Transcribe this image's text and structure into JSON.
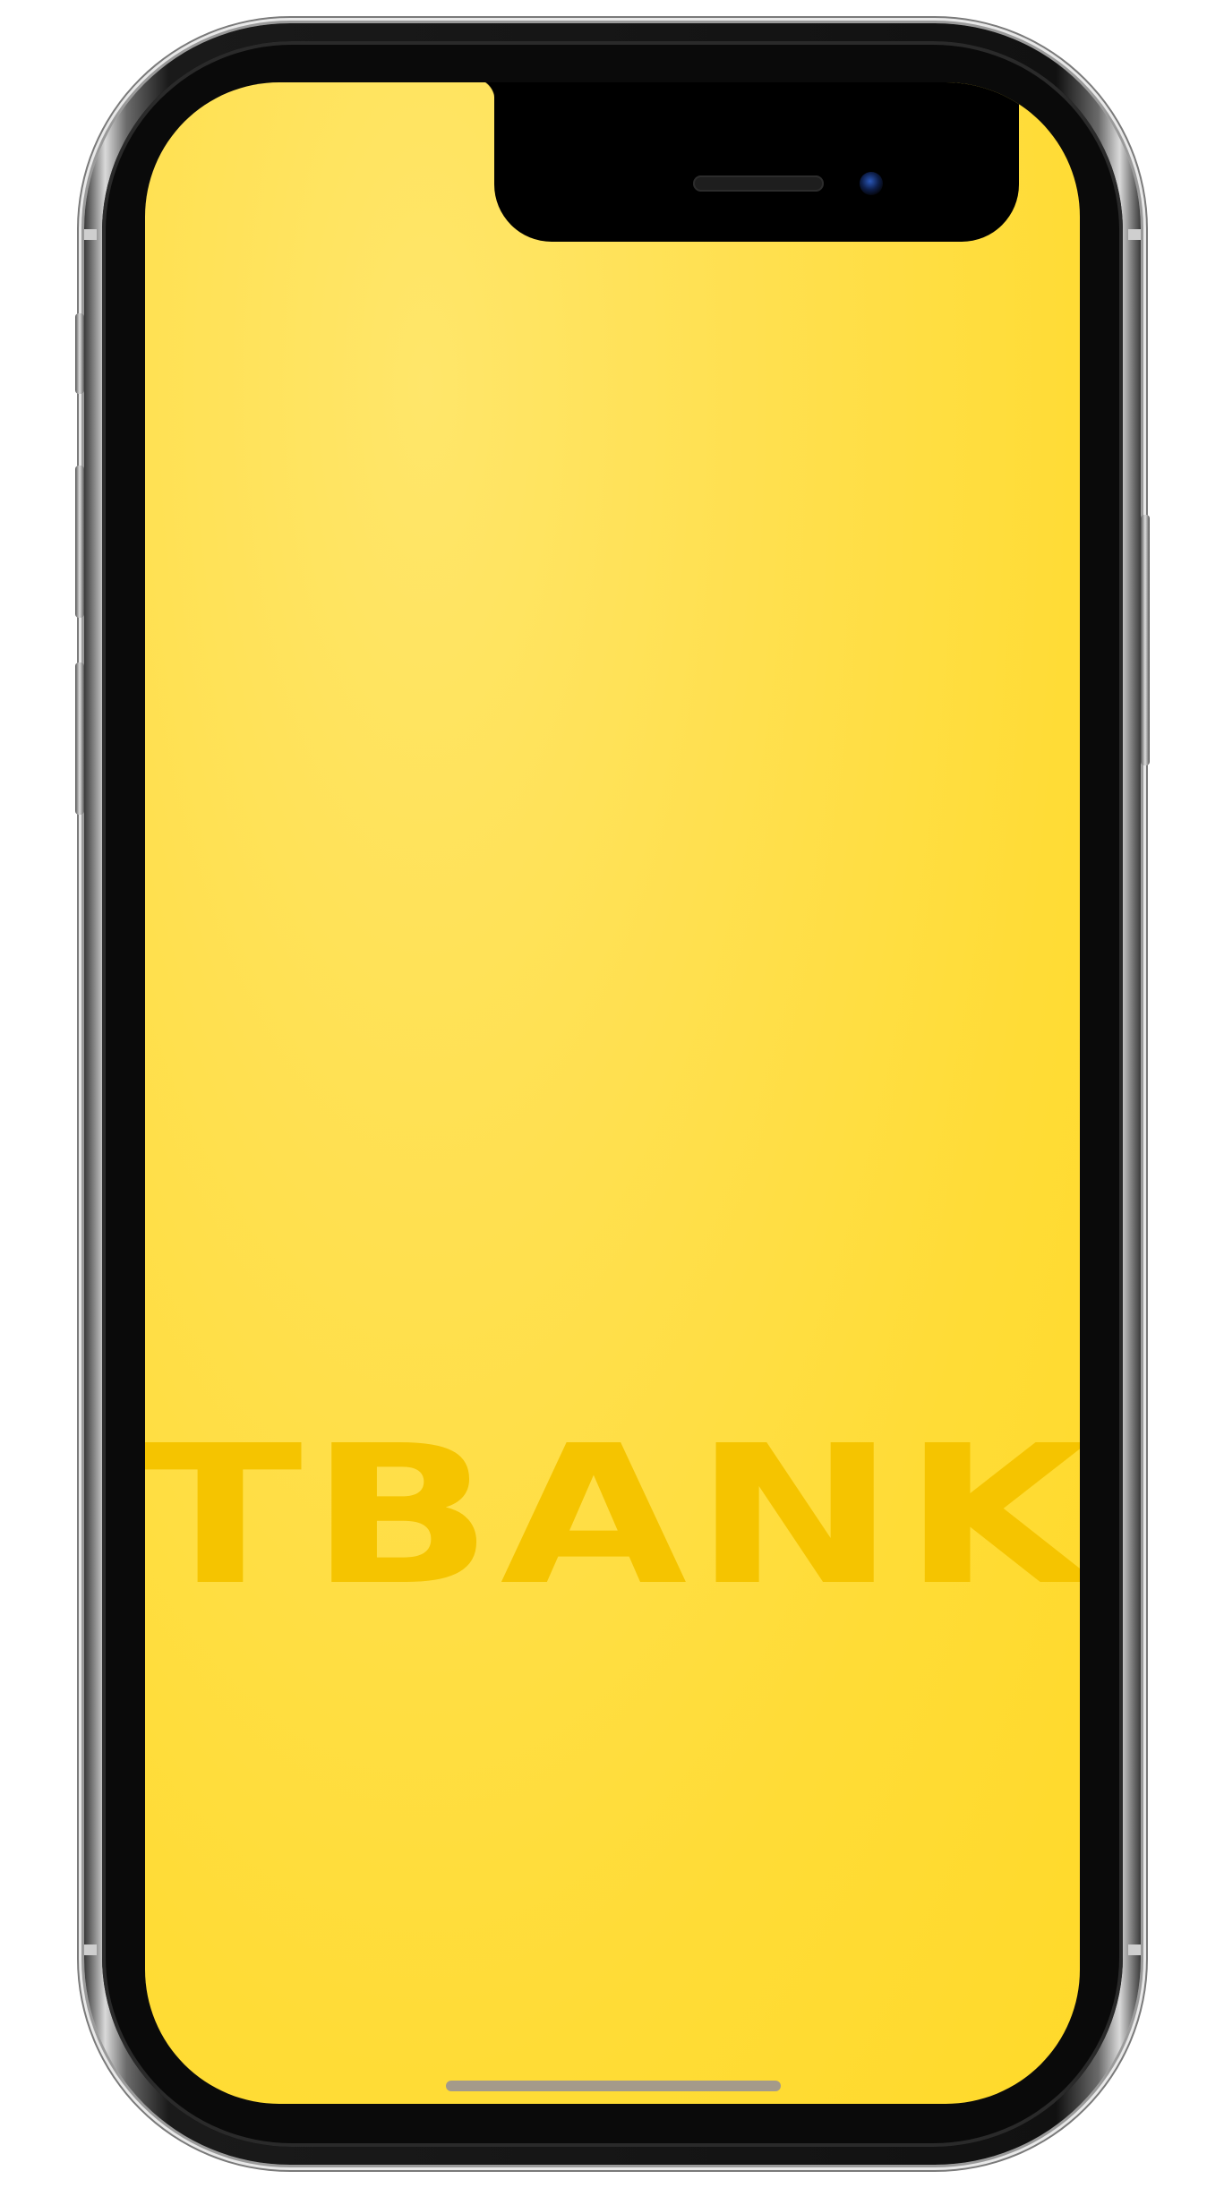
{
  "app": {
    "brand_name": "TBANK"
  },
  "device": {
    "model": "smartphone",
    "notch": {
      "speaker": "speaker-grille",
      "camera": "front-camera"
    }
  },
  "screen": {
    "background_color": "#FFDC36",
    "wordmark_color": "#F5C400",
    "home_indicator_color": "#A49A8A"
  }
}
